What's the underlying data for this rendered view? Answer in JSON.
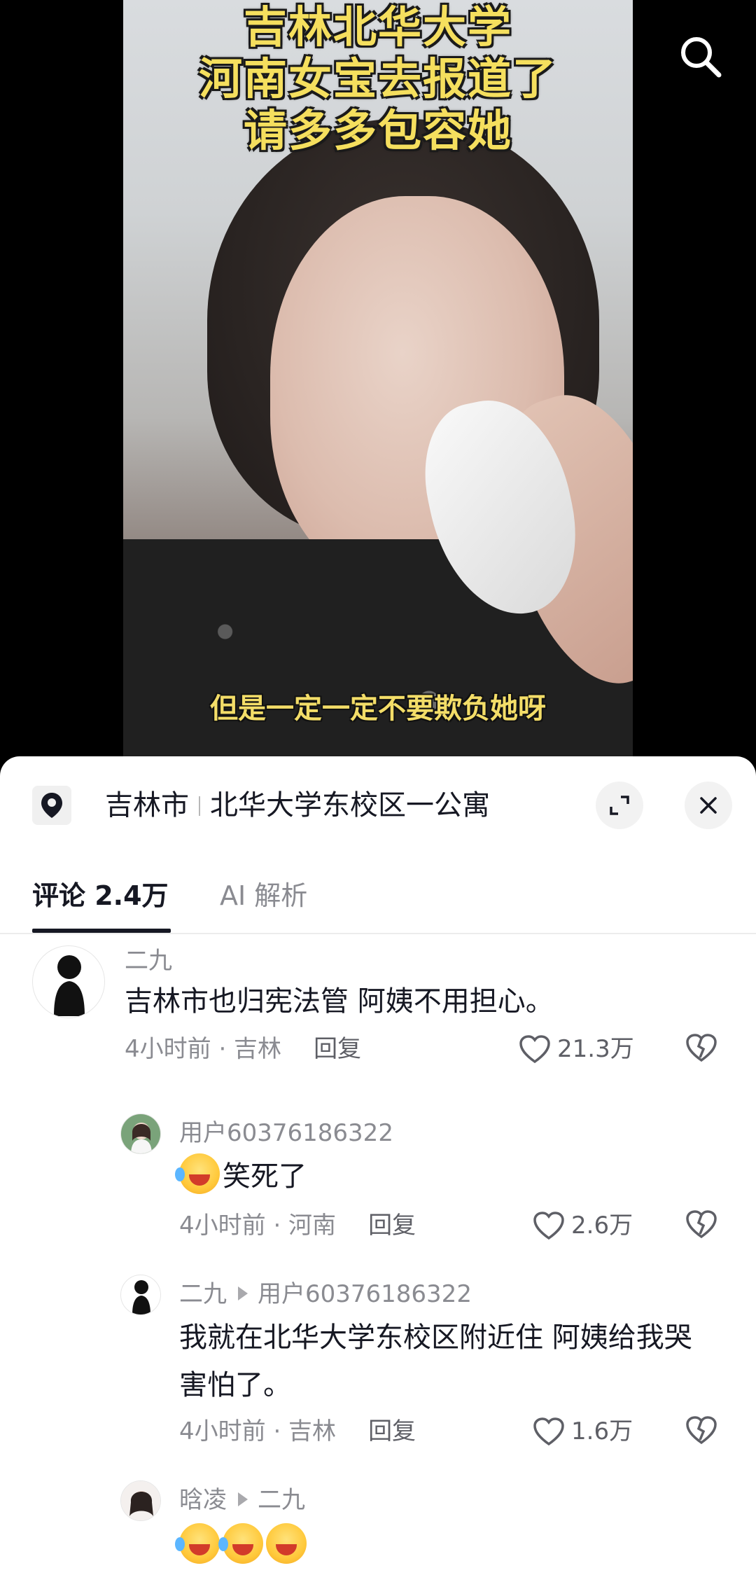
{
  "video": {
    "caption_lines": [
      "吉林北华大学",
      "河南女宝去报道了",
      "请多多包容她"
    ],
    "subtitle": "但是一定一定不要欺负她呀"
  },
  "location_bar": {
    "city": "吉林市",
    "place": "北华大学东校区一公寓"
  },
  "tabs": [
    {
      "label": "评论 2.4万",
      "active": true
    },
    {
      "label": "AI 解析",
      "active": false
    }
  ],
  "comments": [
    {
      "author": "二九",
      "text": "吉林市也归宪法管 阿姨不用担心。",
      "time_location": "4小时前 · 吉林",
      "reply_label": "回复",
      "likes": "21.3万"
    },
    {
      "author": "用户60376186322",
      "text": "笑死了",
      "emoji": [
        "laugh-cry"
      ],
      "time_location": "4小时前 · 河南",
      "reply_label": "回复",
      "likes": "2.6万"
    },
    {
      "author": "二九",
      "reply_to": "用户60376186322",
      "text": "我就在北华大学东校区附近住 阿姨给我哭害怕了。",
      "time_location": "4小时前 · 吉林",
      "reply_label": "回复",
      "likes": "1.6万"
    },
    {
      "author": "晗凌",
      "reply_to": "二九",
      "emoji": [
        "laugh-cry",
        "laugh-cry",
        "joy"
      ]
    }
  ],
  "colors": {
    "caption_yellow": "#f5df5e",
    "text_primary": "#161823",
    "text_secondary": "#8a8b91"
  }
}
